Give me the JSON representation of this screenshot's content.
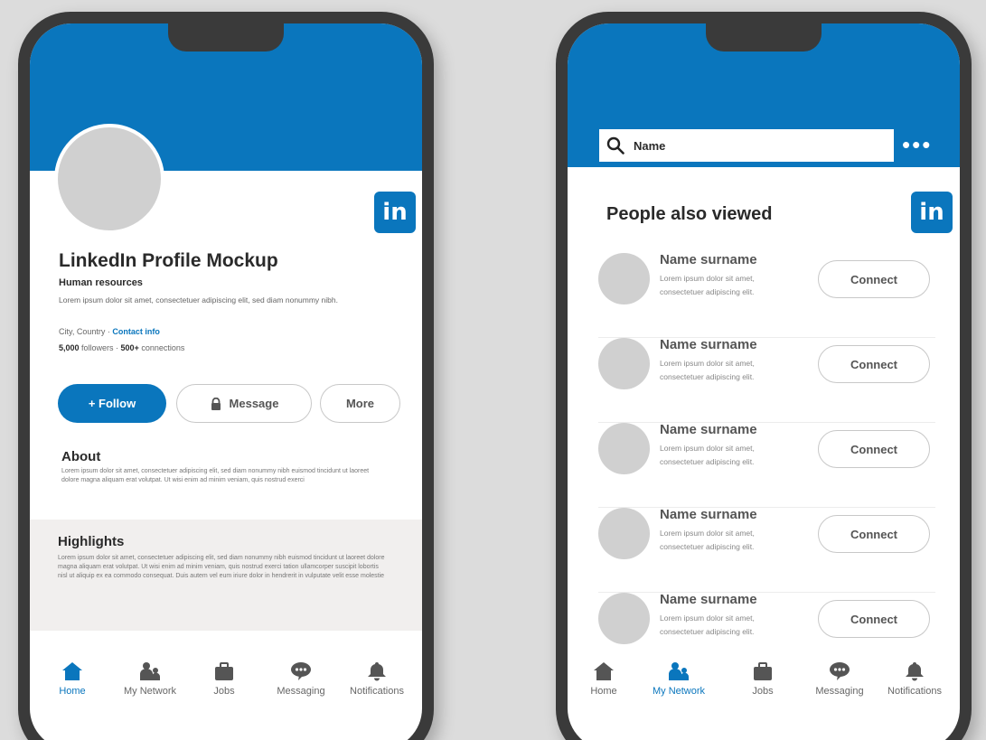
{
  "profile_screen": {
    "badge": "in",
    "name": "LinkedIn Profile Mockup",
    "role": "Human resources",
    "bio": "Lorem ipsum dolor sit amet, consectetuer adipiscing elit, sed diam nonummy nibh.",
    "location": "City, Country",
    "location_sep": " · ",
    "contact_link": "Contact info",
    "followers_count": "5,000",
    "followers_label": " followers · ",
    "connections_count": "500+",
    "connections_label": " connections",
    "buttons": {
      "follow": "+ Follow",
      "message": "Message",
      "more": "More"
    },
    "about": {
      "title": "About",
      "text": "Lorem ipsum dolor sit amet, consectetuer adipiscing elit, sed diam nonummy nibh euismod tincidunt ut laoreet dolore magna aliquam erat volutpat. Ut wisi enim ad minim veniam, quis nostrud exerci"
    },
    "highlights": {
      "title": "Highlights",
      "text": "Lorem ipsum dolor sit amet, consectetuer adipiscing elit, sed diam nonummy nibh euismod tincidunt ut laoreet dolore magna aliquam erat volutpat. Ut wisi enim ad minim veniam, quis nostrud exerci tation ullamcorper suscipit lobortis nisl ut aliquip ex ea commodo consequat. Duis autem vel eum iriure dolor in hendrerit in vulputate velit esse molestie"
    }
  },
  "network_screen": {
    "badge": "in",
    "search_value": "Name",
    "more_dots": "•••",
    "section_title": "People also viewed",
    "people": [
      {
        "name": "Name surname",
        "line1": "Lorem ipsum dolor sit amet,",
        "line2": "consectetuer adipiscing elit.",
        "button": "Connect"
      },
      {
        "name": "Name surname",
        "line1": "Lorem ipsum dolor sit amet,",
        "line2": "consectetuer adipiscing elit.",
        "button": "Connect"
      },
      {
        "name": "Name surname",
        "line1": "Lorem ipsum dolor sit amet,",
        "line2": "consectetuer adipiscing elit.",
        "button": "Connect"
      },
      {
        "name": "Name surname",
        "line1": "Lorem ipsum dolor sit amet,",
        "line2": "consectetuer adipiscing elit.",
        "button": "Connect"
      },
      {
        "name": "Name surname",
        "line1": "Lorem ipsum dolor sit amet,",
        "line2": "consectetuer adipiscing elit.",
        "button": "Connect"
      }
    ]
  },
  "nav": {
    "home": "Home",
    "network": "My Network",
    "jobs": "Jobs",
    "messaging": "Messaging",
    "notifications": "Notifications"
  },
  "colors": {
    "brand_blue": "#0a76bd",
    "nav_inactive": "#666666",
    "placeholder_gray": "#d0d0d0"
  },
  "icons": [
    "home-icon",
    "network-icon",
    "jobs-icon",
    "messaging-icon",
    "notifications-icon",
    "search-icon",
    "lock-icon"
  ]
}
